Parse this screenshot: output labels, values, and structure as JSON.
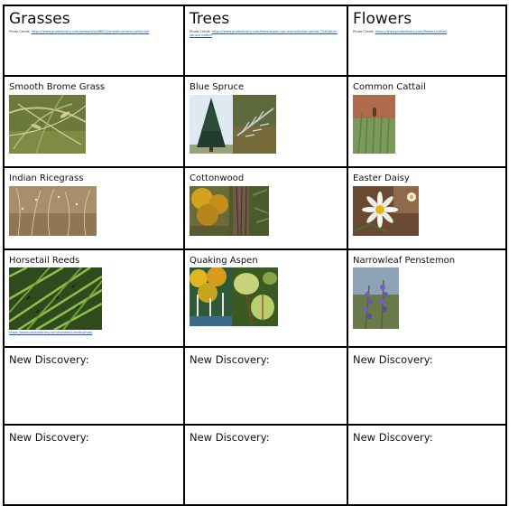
{
  "columns": [
    {
      "title": "Grasses",
      "credit_label": "Photo Credit:",
      "credit_url": "https://www.photolibrary.com/grasses/lsdf8823/smooth-brome-collection"
    },
    {
      "title": "Trees",
      "credit_label": "Photo Credit:",
      "credit_url": "https://www.photolibrary.com/trees/aspen-spruce/collection-photo-7248/blue-spruce-cotton"
    },
    {
      "title": "Flowers",
      "credit_label": "Photo Credit:",
      "credit_url": "https://www.photolibrary.com/flowers/cattail"
    }
  ],
  "rows": [
    [
      "Smooth Brome Grass",
      "Blue Spruce",
      "Common Cattail"
    ],
    [
      "Indian Ricegrass",
      "Cottonwood",
      "Easter Daisy"
    ],
    [
      "Horsetail Reeds",
      "Quaking Aspen",
      "Narrowleaf Penstemon"
    ]
  ],
  "horsetail_credit": "https://www.photolibrary.com/horsetail-reeds/photo",
  "new_discovery_label": "New Discovery:"
}
